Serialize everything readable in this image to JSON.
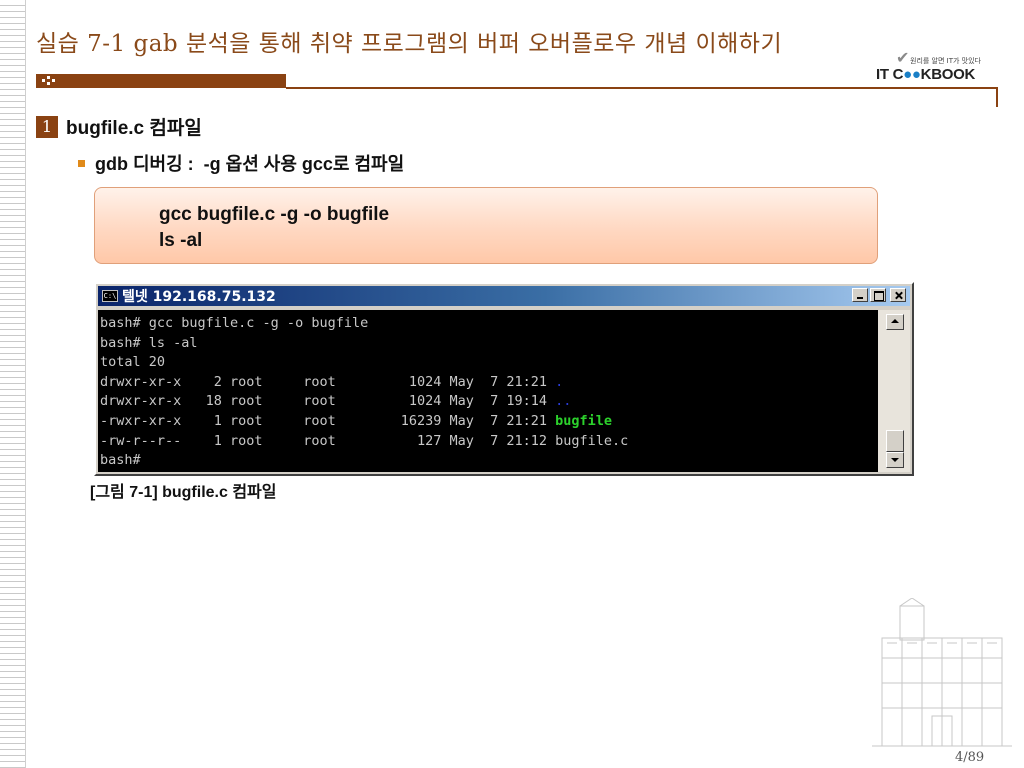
{
  "slide": {
    "title": "실습 7-1 gab 분석을 통해 취약 프로그램의 버퍼 오버플로우 개념 이해하기",
    "page_number": "4/89"
  },
  "logo": {
    "tagline": "원리를 알면 IT가 맛있다",
    "text_it": "IT C",
    "text_oo": "●●",
    "text_kbook": "KBOOK"
  },
  "section": {
    "number": "1",
    "title": "bugfile.c 컴파일"
  },
  "bullet": {
    "text": "gdb 디버깅 :  -g 옵션 사용 gcc로 컴파일"
  },
  "code_box": {
    "lines": [
      "gcc bugfile.c -g -o bugfile",
      "ls -al"
    ]
  },
  "terminal": {
    "icon_label": "C:\\",
    "title": "텔넷 192.168.75.132",
    "lines": [
      {
        "text": "bash# gcc bugfile.c -g -o bugfile",
        "name": "",
        "name_color": ""
      },
      {
        "text": "bash# ls -al",
        "name": "",
        "name_color": ""
      },
      {
        "text": "total 20",
        "name": "",
        "name_color": ""
      },
      {
        "text": "drwxr-xr-x    2 root     root         1024 May  7 21:21 ",
        "name": ".",
        "name_color": "blue"
      },
      {
        "text": "drwxr-xr-x   18 root     root         1024 May  7 19:14 ",
        "name": "..",
        "name_color": "blue"
      },
      {
        "text": "-rwxr-xr-x    1 root     root        16239 May  7 21:21 ",
        "name": "bugfile",
        "name_color": "green"
      },
      {
        "text": "-rw-r--r--    1 root     root          127 May  7 21:12 bugfile.c",
        "name": "",
        "name_color": ""
      },
      {
        "text": "bash#",
        "name": "",
        "name_color": ""
      }
    ]
  },
  "caption": "[그림 7-1] bugfile.c 컴파일"
}
